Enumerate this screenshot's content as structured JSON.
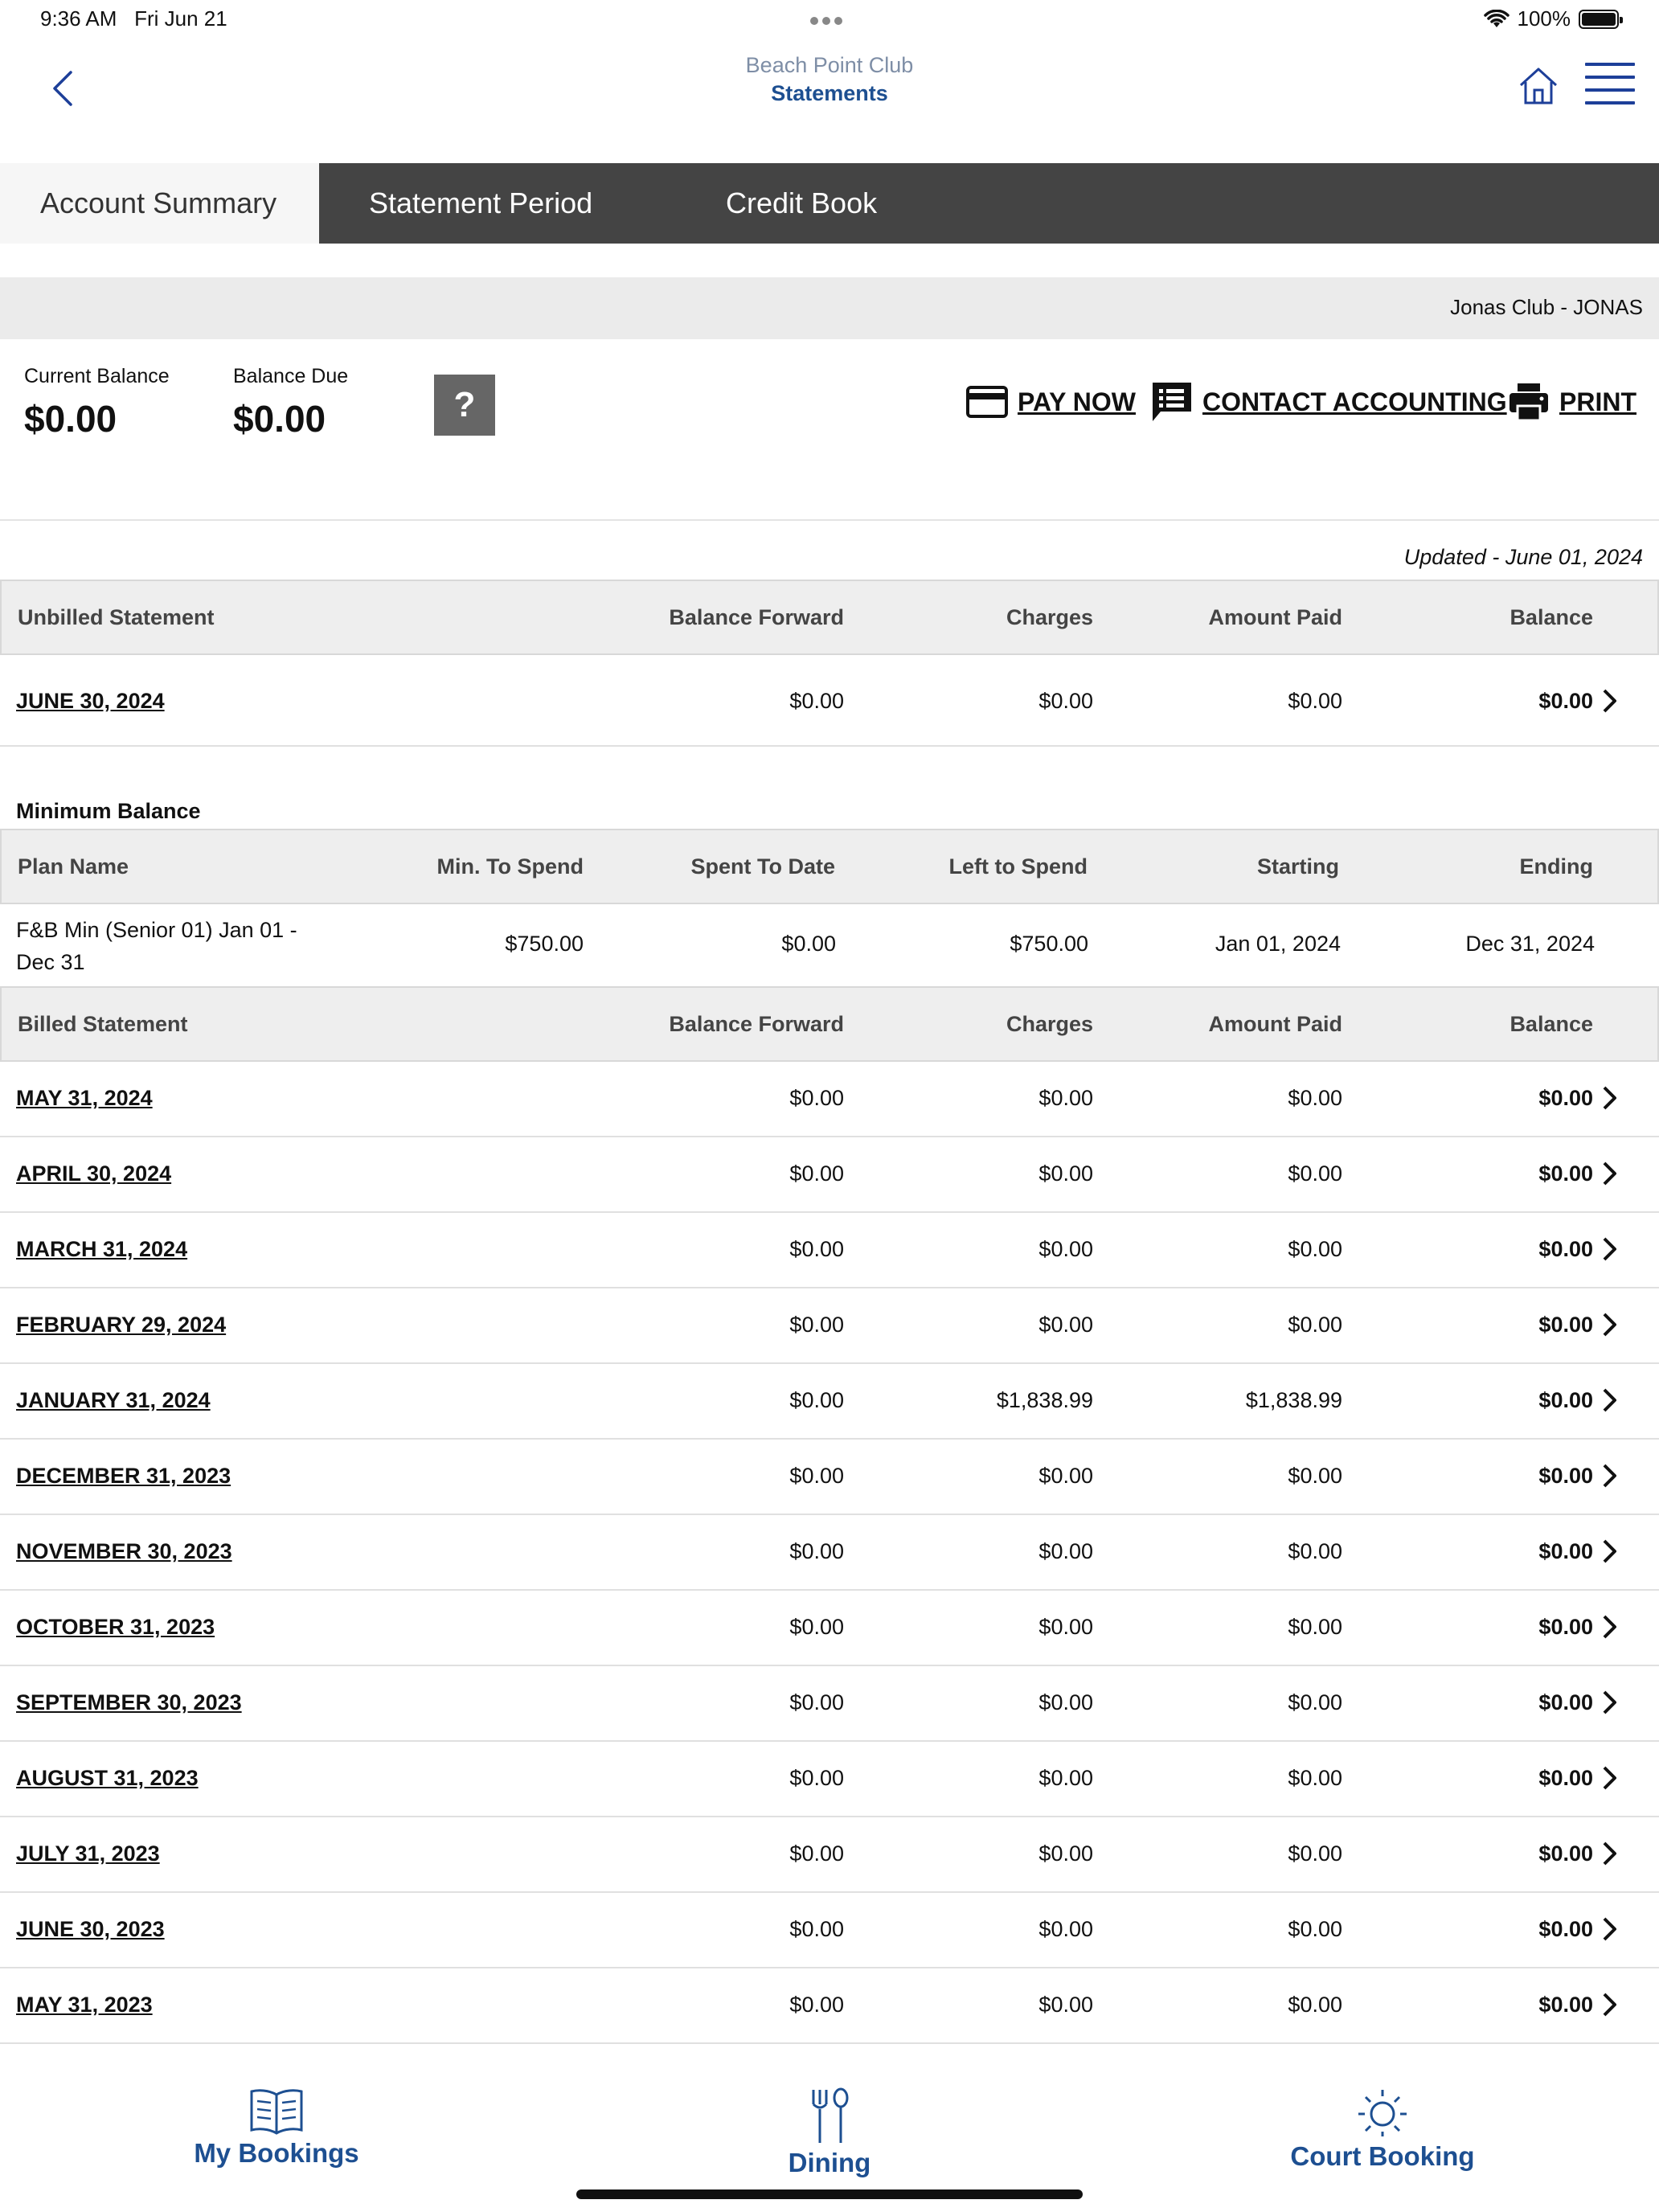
{
  "status_bar": {
    "time": "9:36 AM",
    "date": "Fri Jun 21",
    "battery": "100%"
  },
  "header": {
    "club_name": "Beach Point Club",
    "page_title": "Statements"
  },
  "tabs": [
    {
      "label": "Account Summary",
      "active": true
    },
    {
      "label": "Statement Period",
      "active": false
    },
    {
      "label": "Credit Book",
      "active": false
    }
  ],
  "club_bar": {
    "text": "Jonas Club - JONAS"
  },
  "balances": {
    "current_label": "Current Balance",
    "current_value": "$0.00",
    "due_label": "Balance Due",
    "due_value": "$0.00",
    "help_label": "?"
  },
  "actions": {
    "pay_now": "PAY NOW",
    "contact": "CONTACT ACCOUNTING",
    "print": "PRINT"
  },
  "updated": "Updated - June 01, 2024",
  "unbilled": {
    "headers": {
      "name": "Unbilled Statement",
      "forward": "Balance Forward",
      "charges": "Charges",
      "paid": "Amount Paid",
      "balance": "Balance"
    },
    "rows": [
      {
        "date": "JUNE 30, 2024",
        "forward": "$0.00",
        "charges": "$0.00",
        "paid": "$0.00",
        "balance": "$0.00"
      }
    ]
  },
  "minimum_balance": {
    "title": "Minimum Balance",
    "headers": {
      "plan": "Plan Name",
      "min": "Min. To Spend",
      "spent": "Spent To Date",
      "left": "Left to Spend",
      "starting": "Starting",
      "ending": "Ending"
    },
    "rows": [
      {
        "plan_line1": "F&B Min (Senior 01) Jan 01 -",
        "plan_line2": "Dec 31",
        "min": "$750.00",
        "spent": "$0.00",
        "left": "$750.00",
        "starting": "Jan 01, 2024",
        "ending": "Dec 31, 2024"
      }
    ]
  },
  "billed": {
    "headers": {
      "name": "Billed Statement",
      "forward": "Balance Forward",
      "charges": "Charges",
      "paid": "Amount Paid",
      "balance": "Balance"
    },
    "rows": [
      {
        "date": "MAY 31, 2024",
        "forward": "$0.00",
        "charges": "$0.00",
        "paid": "$0.00",
        "balance": "$0.00"
      },
      {
        "date": "APRIL 30, 2024",
        "forward": "$0.00",
        "charges": "$0.00",
        "paid": "$0.00",
        "balance": "$0.00"
      },
      {
        "date": "MARCH 31, 2024",
        "forward": "$0.00",
        "charges": "$0.00",
        "paid": "$0.00",
        "balance": "$0.00"
      },
      {
        "date": "FEBRUARY 29, 2024",
        "forward": "$0.00",
        "charges": "$0.00",
        "paid": "$0.00",
        "balance": "$0.00"
      },
      {
        "date": "JANUARY 31, 2024",
        "forward": "$0.00",
        "charges": "$1,838.99",
        "paid": "$1,838.99",
        "balance": "$0.00"
      },
      {
        "date": "DECEMBER 31, 2023",
        "forward": "$0.00",
        "charges": "$0.00",
        "paid": "$0.00",
        "balance": "$0.00"
      },
      {
        "date": "NOVEMBER 30, 2023",
        "forward": "$0.00",
        "charges": "$0.00",
        "paid": "$0.00",
        "balance": "$0.00"
      },
      {
        "date": "OCTOBER 31, 2023",
        "forward": "$0.00",
        "charges": "$0.00",
        "paid": "$0.00",
        "balance": "$0.00"
      },
      {
        "date": "SEPTEMBER 30, 2023",
        "forward": "$0.00",
        "charges": "$0.00",
        "paid": "$0.00",
        "balance": "$0.00"
      },
      {
        "date": "AUGUST 31, 2023",
        "forward": "$0.00",
        "charges": "$0.00",
        "paid": "$0.00",
        "balance": "$0.00"
      },
      {
        "date": "JULY 31, 2023",
        "forward": "$0.00",
        "charges": "$0.00",
        "paid": "$0.00",
        "balance": "$0.00"
      },
      {
        "date": "JUNE 30, 2023",
        "forward": "$0.00",
        "charges": "$0.00",
        "paid": "$0.00",
        "balance": "$0.00"
      },
      {
        "date": "MAY 31, 2023",
        "forward": "$0.00",
        "charges": "$0.00",
        "paid": "$0.00",
        "balance": "$0.00"
      }
    ]
  },
  "bottom_nav": [
    {
      "label": "My Bookings",
      "icon": "book-icon"
    },
    {
      "label": "Dining",
      "icon": "fork-spoon-icon"
    },
    {
      "label": "Court Booking",
      "icon": "sun-icon"
    }
  ],
  "colors": {
    "accent": "#1d4f91",
    "tab_bar": "#444444",
    "header_bg": "#eeeeee"
  }
}
